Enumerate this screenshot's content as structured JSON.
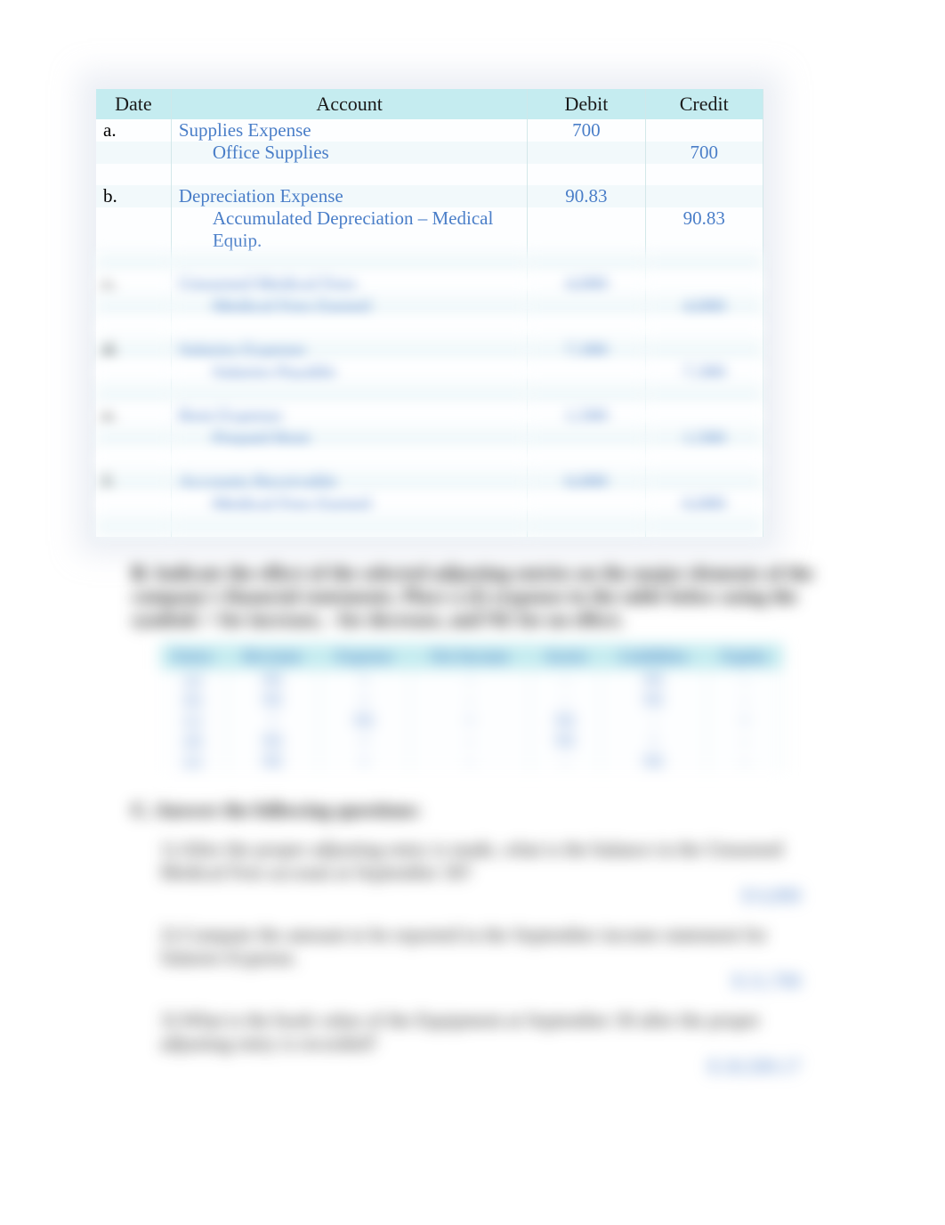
{
  "journal": {
    "headers": {
      "date": "Date",
      "account": "Account",
      "debit": "Debit",
      "credit": "Credit"
    },
    "rows": [
      {
        "date": "a.",
        "account": "Supplies Expense",
        "debit": "700",
        "credit": ""
      },
      {
        "date": "",
        "account_indent": "Office Supplies",
        "debit": "",
        "credit": "700"
      },
      {
        "blank": true
      },
      {
        "date": "b.",
        "account": "Depreciation Expense",
        "debit": "90.83",
        "credit": ""
      },
      {
        "date": "",
        "account_indent": "Accumulated Depreciation – Medical Equip.",
        "debit": "",
        "credit": "90.83"
      },
      {
        "blank": true
      },
      {
        "date": "c.",
        "account": "Unearned Medical Fees",
        "debit": "4,000",
        "credit": ""
      },
      {
        "date": "",
        "account_indent": "Medical Fees Earned",
        "debit": "",
        "credit": "4,000"
      },
      {
        "blank": true
      },
      {
        "date": "d.",
        "account": "Salaries Expense",
        "debit": "7,300",
        "credit": ""
      },
      {
        "date": "",
        "account_indent": "Salaries Payable",
        "debit": "",
        "credit": "7,300"
      },
      {
        "blank": true
      },
      {
        "date": "e.",
        "account": "Rent Expense",
        "debit": "1,500",
        "credit": ""
      },
      {
        "date": "",
        "account_indent": "Prepaid Rent",
        "debit": "",
        "credit": "1,500"
      },
      {
        "blank": true
      },
      {
        "date": "f.",
        "account": "Accounts Receivable",
        "debit": "6,000",
        "credit": ""
      },
      {
        "date": "",
        "account_indent": "Medical Fees Earned",
        "debit": "",
        "credit": "6,000"
      },
      {
        "blank": true
      }
    ]
  },
  "sectionB": {
    "prompt": "Indicate the effect of the selected adjusting entries on the major elements of the company's financial statements.  Place a (I) response in the table below using the symbols + for increase, - for decrease, and NE for no effect.",
    "headers": [
      "Entry",
      "Revenue",
      "Expense",
      "Net Income",
      "Assets",
      "Liabilities",
      "Equity"
    ],
    "rows": [
      [
        "(a)",
        "NE",
        "+",
        "-",
        "-",
        "NE",
        "-"
      ],
      [
        "(b)",
        "NE",
        "+",
        "-",
        "-",
        "NE",
        "-"
      ],
      [
        "(c)",
        "+",
        "NE",
        "+",
        "NE",
        "-",
        "+"
      ],
      [
        "(d)",
        "NE",
        "+",
        "-",
        "NE",
        "+",
        "-"
      ],
      [
        "(e)",
        "NE",
        "+",
        "-",
        "-",
        "NE",
        "-"
      ]
    ]
  },
  "sectionC": {
    "heading": "Answer the following questions:",
    "q1": "1) After the proper adjusting entry is made, what is the balance in the Unearned Medical Fees account at September 30?",
    "a1": "$    6,000",
    "q2": "2) Compute the amount to be reported in the September income statement for Salaries Expense.",
    "a2": "$   21,700",
    "q3": "3) What is the book value of the Equipment at September 30 after the proper adjusting entry is recorded?",
    "a3": "$   20,509.17"
  }
}
